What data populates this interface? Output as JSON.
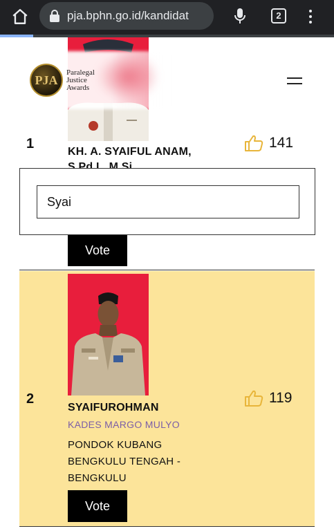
{
  "browser": {
    "url": "pja.bphn.go.id/kandidat",
    "tab_count": "2",
    "load_progress": 0.1
  },
  "header": {
    "logo_mark": "PJA",
    "logo_lines": [
      "Paralegal",
      "Justice",
      "Awards"
    ]
  },
  "search": {
    "value": "Syai"
  },
  "candidates": [
    {
      "rank": "1",
      "votes": "141",
      "name_line1": "KH. A. SYAIFUL ANAM,",
      "name_line2": "S.Pd.I., M.Si",
      "vote_label": "Vote"
    },
    {
      "rank": "2",
      "votes": "119",
      "name": "SYAIFUROHMAN",
      "title": "KADES MARGO MULYO",
      "address_lines": [
        "PONDOK KUBANG",
        "BENGKULU TENGAH -",
        "BENGKULU"
      ],
      "vote_label": "Vote"
    }
  ],
  "colors": {
    "highlight": "#fce49a",
    "photo_bg": "#e81e3c",
    "thumb_icon": "#e8b53a",
    "title_purple": "#7b5ea7"
  },
  "icons": [
    "home-icon",
    "lock-icon",
    "mic-icon",
    "tab-switcher-icon",
    "kebab-menu-icon",
    "thumbs-up-icon",
    "hamburger-menu-icon"
  ]
}
